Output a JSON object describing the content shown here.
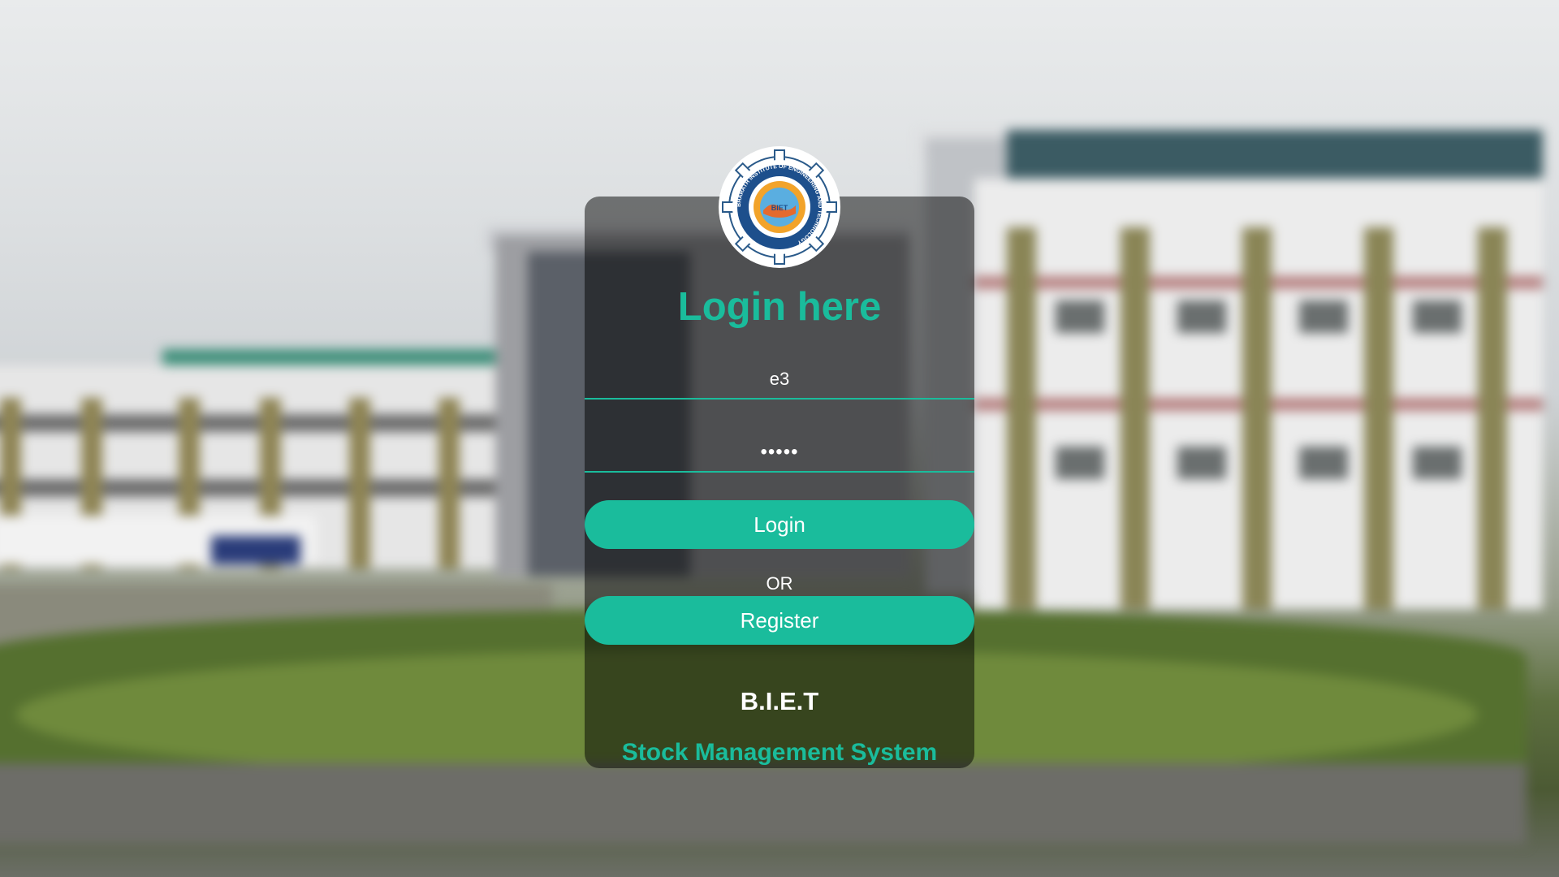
{
  "login_card": {
    "title": "Login here",
    "username_value": "e3",
    "password_value": "•••••",
    "login_label": "Login",
    "or_text": "OR",
    "register_label": "Register",
    "org_name": "B.I.E.T",
    "app_name": "Stock Management System"
  },
  "logo": {
    "ring_text": "BHARATH INSTITUTE OF ENGINEERING AND TECHNOLOGY",
    "inner_text": "BIET"
  },
  "colors": {
    "accent": "#1abc9c",
    "card_overlay": "rgba(0,0,0,0.5)",
    "text": "#ffffff"
  }
}
